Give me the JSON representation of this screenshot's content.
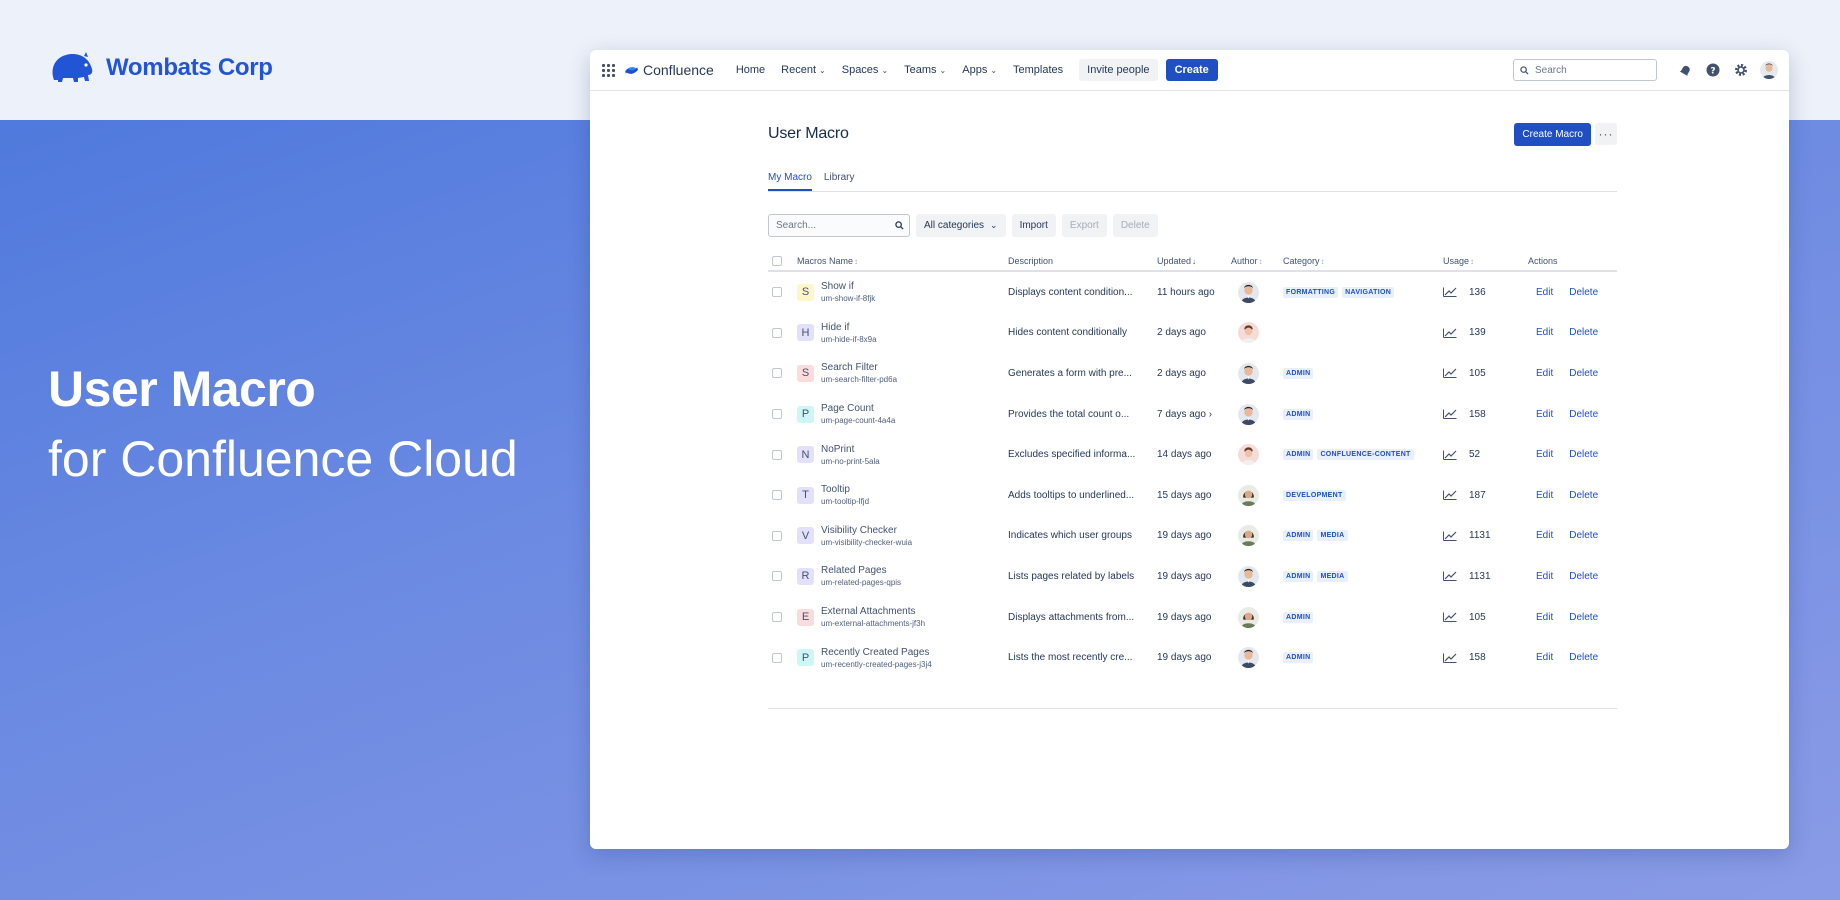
{
  "brand": {
    "name": "Wombats Corp"
  },
  "hero": {
    "title": "User Macro",
    "subtitle": "for Confluence Cloud"
  },
  "nav": {
    "logo": "Confluence",
    "items": [
      "Home",
      "Recent",
      "Spaces",
      "Teams",
      "Apps",
      "Templates"
    ],
    "invite": "Invite people",
    "create": "Create",
    "search_placeholder": "Search"
  },
  "page": {
    "title": "User Macro",
    "create_button": "Create Macro",
    "tabs": [
      "My Macro",
      "Library"
    ]
  },
  "toolbar": {
    "search_placeholder": "Search...",
    "categories": "All categories",
    "import": "Import",
    "export": "Export",
    "delete": "Delete"
  },
  "table": {
    "headers": {
      "name": "Macros Name",
      "description": "Description",
      "updated": "Updated",
      "author": "Author",
      "category": "Category",
      "usage": "Usage",
      "actions": "Actions"
    },
    "edit_label": "Edit",
    "delete_label": "Delete",
    "rows": [
      {
        "letter": "S",
        "color": "#fdf6c8",
        "title": "Show if",
        "key": "um-show-if-8fjk",
        "desc": "Displays content condition...",
        "updated": "11 hours ago",
        "author": "male",
        "cats": [
          "FORMATTING",
          "NAVIGATION"
        ],
        "usage": "136"
      },
      {
        "letter": "H",
        "color": "#e2e1f9",
        "title": "Hide if",
        "key": "um-hide-if-8x9a",
        "desc": "Hides content conditionally",
        "updated": "2 days ago",
        "author": "female-pink",
        "cats": [],
        "usage": "139"
      },
      {
        "letter": "S",
        "color": "#fbdcdc",
        "title": "Search Filter",
        "key": "um-search-filter-pd6a",
        "desc": "Generates a form with pre...",
        "updated": "2 days ago",
        "author": "male",
        "cats": [
          "ADMIN"
        ],
        "usage": "105"
      },
      {
        "letter": "P",
        "color": "#cdf6f6",
        "title": "Page Count",
        "key": "um-page-count-4a4a",
        "desc": "Provides the total count o...",
        "updated": "7 days ago ›",
        "author": "male",
        "cats": [
          "ADMIN"
        ],
        "usage": "158"
      },
      {
        "letter": "N",
        "color": "#e2e1f9",
        "title": "NoPrint",
        "key": "um-no-print-5ala",
        "desc": "Excludes specified informa...",
        "updated": "14 days ago",
        "author": "female-pink",
        "cats": [
          "ADMIN",
          "CONFLUENCE-CONTENT"
        ],
        "usage": "52"
      },
      {
        "letter": "T",
        "color": "#e2e1f9",
        "title": "Tooltip",
        "key": "um-tooltip-lfjd",
        "desc": "Adds tooltips to underlined...",
        "updated": "15 days ago",
        "author": "female",
        "cats": [
          "DEVELOPMENT"
        ],
        "usage": "187"
      },
      {
        "letter": "V",
        "color": "#e2e1f9",
        "title": "Visibility Checker",
        "key": "um-visibility-checker-wuia",
        "desc": "Indicates which user groups",
        "updated": "19 days ago",
        "author": "female",
        "cats": [
          "ADMIN",
          "MEDIA"
        ],
        "usage": "1131"
      },
      {
        "letter": "R",
        "color": "#e2e1f9",
        "title": "Related Pages",
        "key": "um-related-pages-qpis",
        "desc": "Lists pages related by labels",
        "updated": "19 days ago",
        "author": "male",
        "cats": [
          "ADMIN",
          "MEDIA"
        ],
        "usage": "1131"
      },
      {
        "letter": "E",
        "color": "#fbdcdc",
        "title": "External Attachments",
        "key": "um-external-attachments-jf3h",
        "desc": "Displays attachments from...",
        "updated": "19 days ago",
        "author": "female",
        "cats": [
          "ADMIN"
        ],
        "usage": "105"
      },
      {
        "letter": "P",
        "color": "#cdf6f6",
        "title": "Recently Created Pages",
        "key": "um-recently-created-pages-j3j4",
        "desc": "Lists the most recently cre...",
        "updated": "19 days ago",
        "author": "male",
        "cats": [
          "ADMIN"
        ],
        "usage": "158"
      }
    ]
  }
}
